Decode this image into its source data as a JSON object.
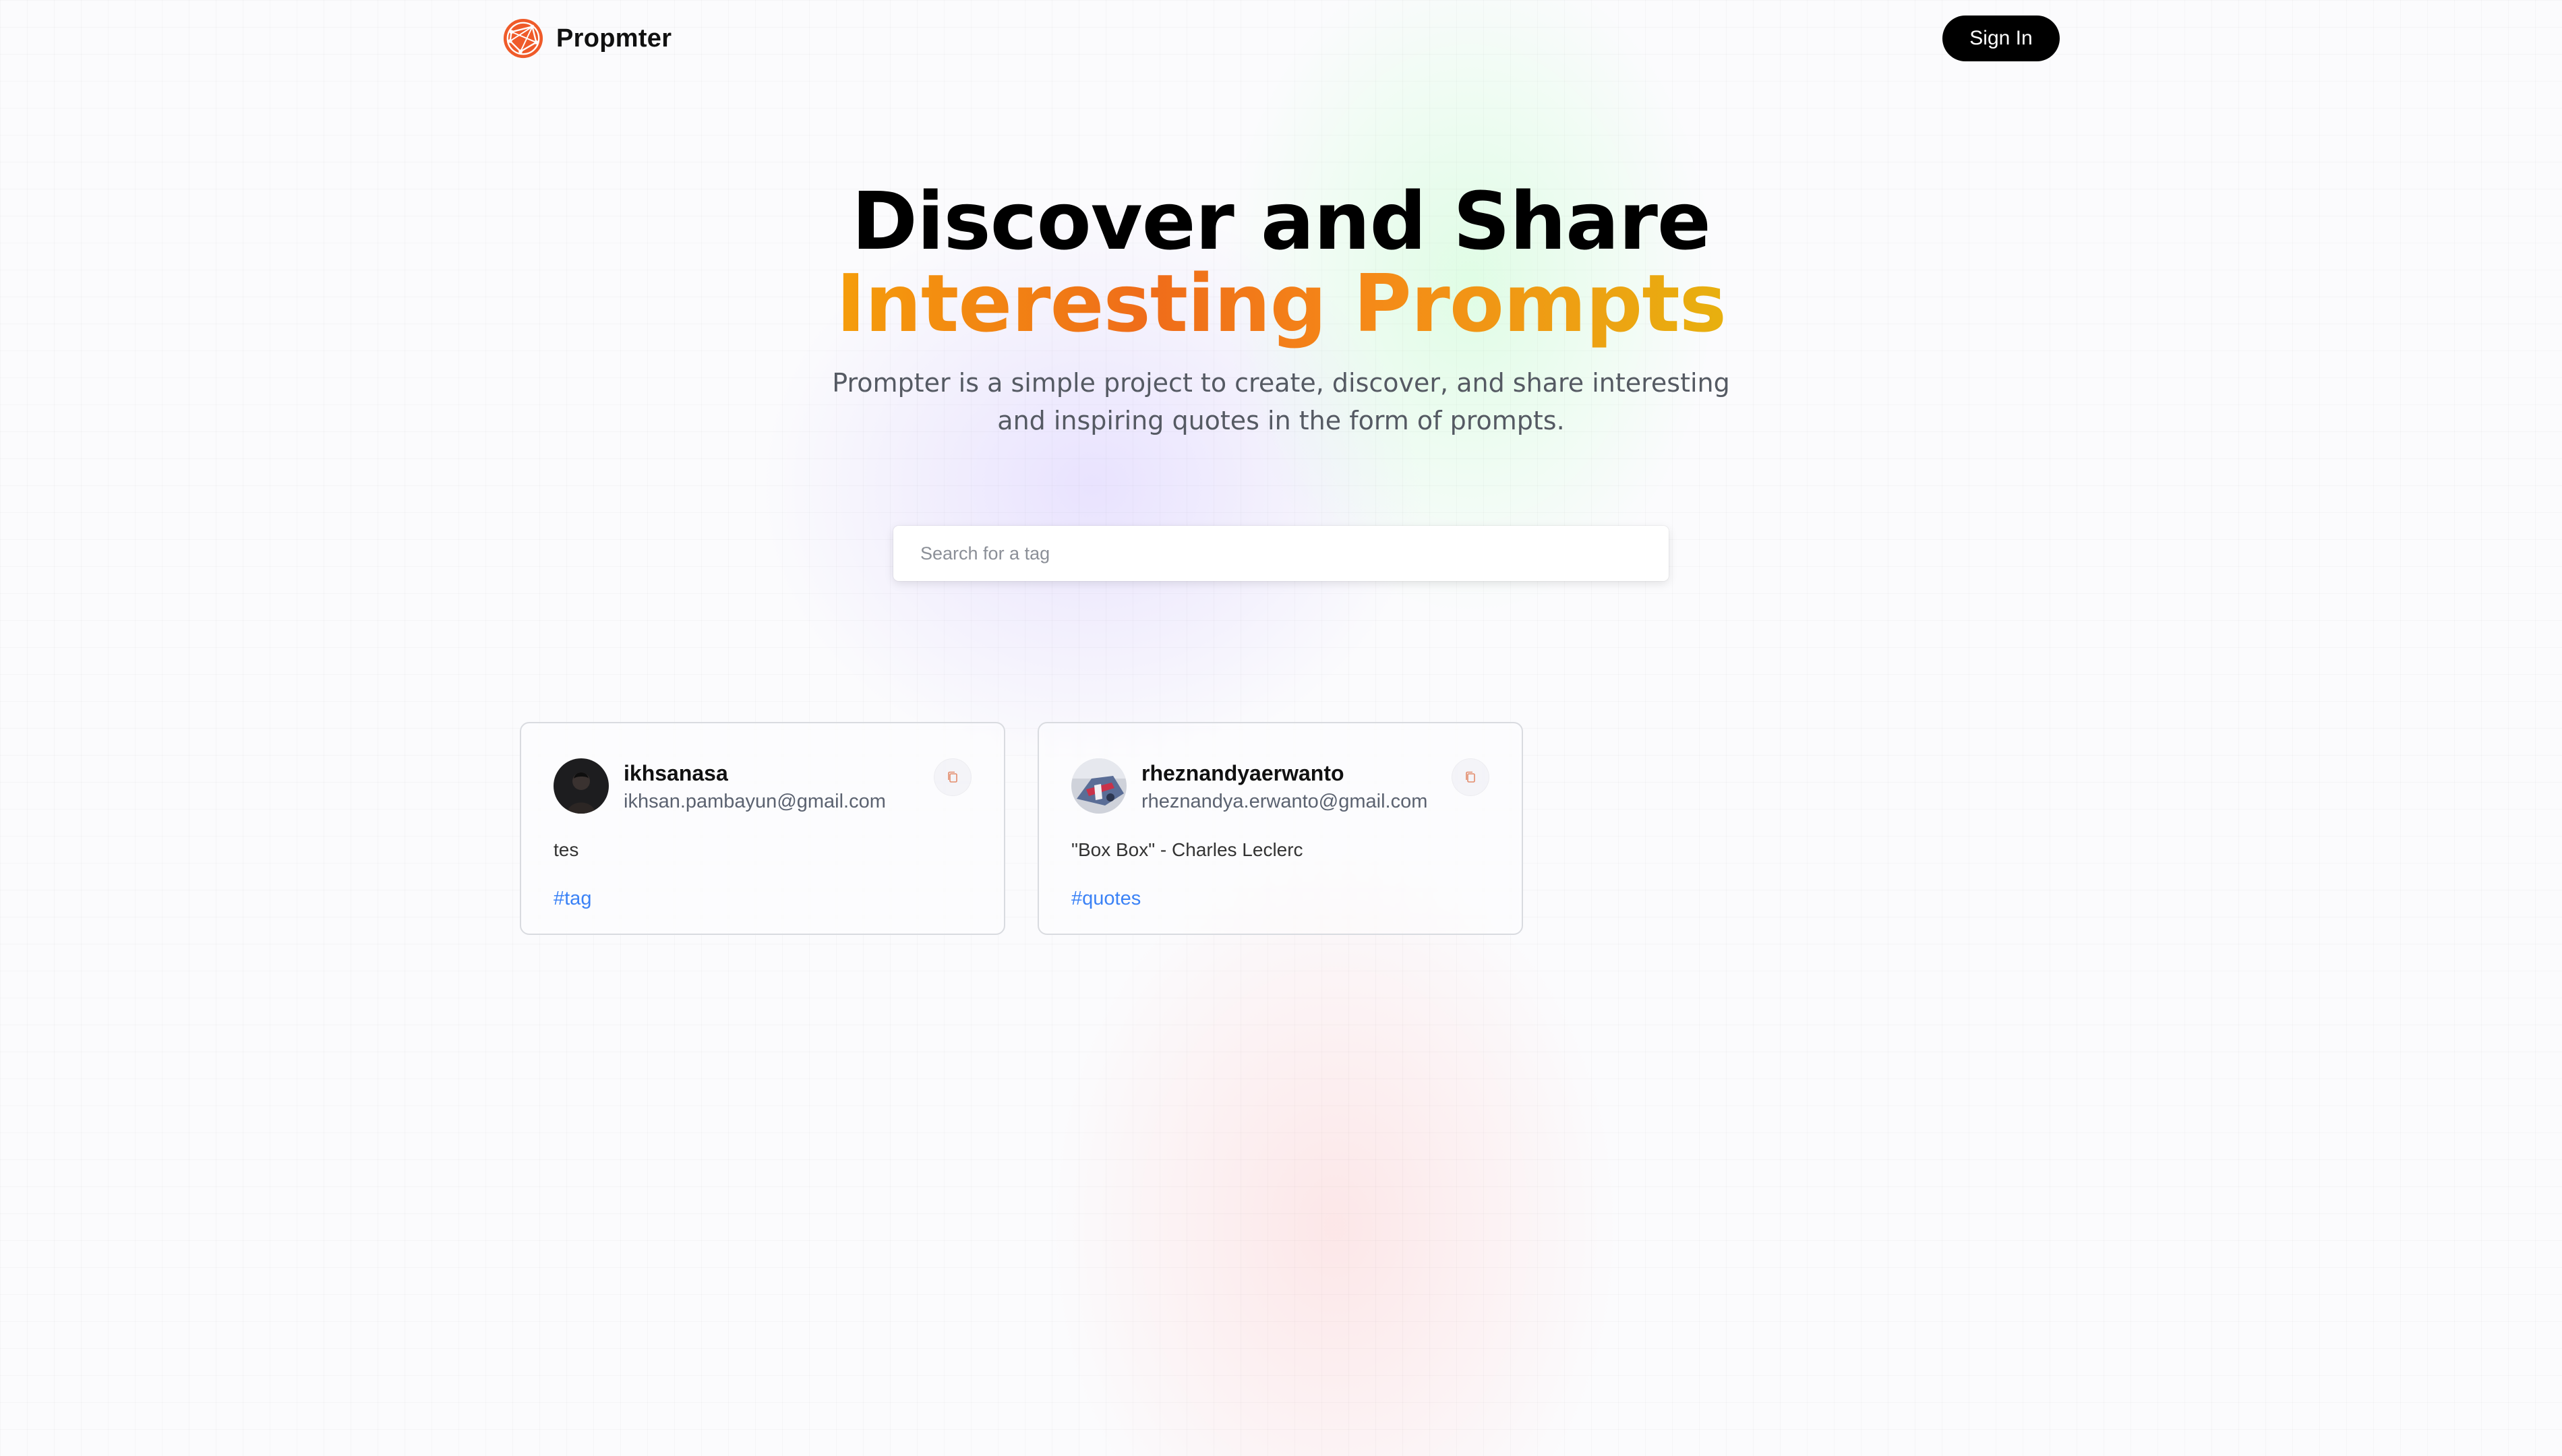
{
  "brand": {
    "name": "Propmter",
    "accent": "#ef5b2a"
  },
  "nav": {
    "signin_label": "Sign In"
  },
  "hero": {
    "title_line1": "Discover and Share",
    "title_line2": "Interesting Prompts",
    "description": "Prompter is a simple project to create, discover, and share interesting and inspiring quotes in the form of prompts."
  },
  "search": {
    "placeholder": "Search for a tag",
    "value": ""
  },
  "prompts": [
    {
      "username": "ikhsanasa",
      "email": "ikhsan.pambayun@gmail.com",
      "prompt": "tes",
      "tag": "#tag",
      "copy_icon": "copy-icon"
    },
    {
      "username": "rheznandyaerwanto",
      "email": "rheznandya.erwanto@gmail.com",
      "prompt": "\"Box Box\" - Charles Leclerc",
      "tag": "#quotes",
      "copy_icon": "copy-icon"
    }
  ],
  "colors": {
    "tag": "#3b82f6",
    "gradient_start": "#f59e0b",
    "gradient_mid": "#ef6c1a",
    "gradient_end": "#e8b00f",
    "button_bg": "#000000"
  }
}
